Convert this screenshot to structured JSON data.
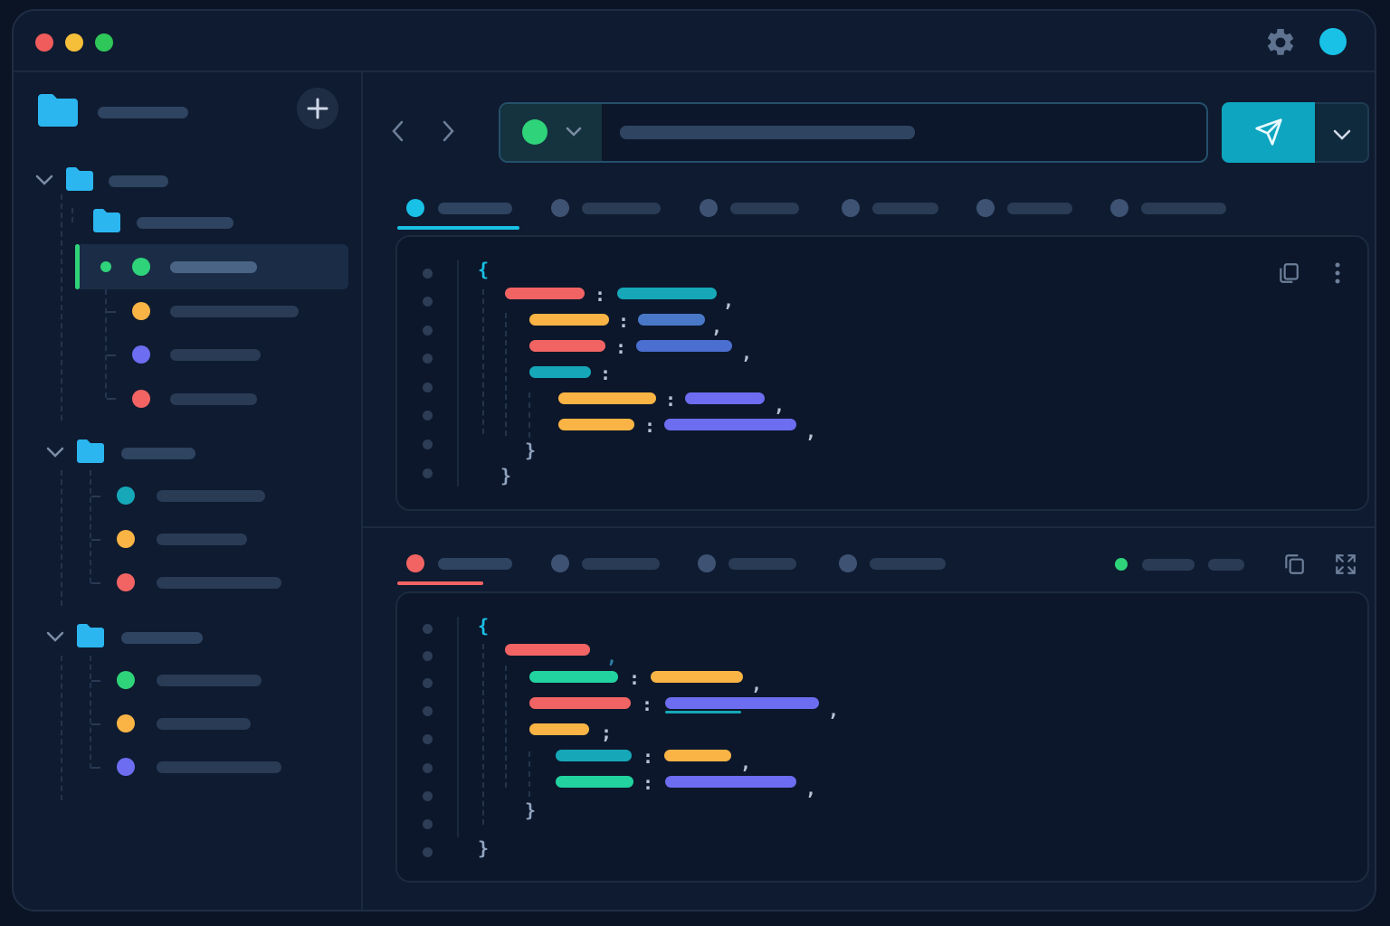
{
  "theme": {
    "accent": "#19c1e6",
    "bg": "#0f1b30",
    "panel": "#0c172b",
    "green": "#2fd37a",
    "orange": "#f9b445",
    "red": "#f26464",
    "purple": "#6c6df0",
    "teal": "#16a8b8",
    "folder": "#2bb6f0"
  },
  "titlebar": {
    "traffic_lights": [
      "#f05b5b",
      "#f5bf3a",
      "#2fc65a"
    ],
    "icons": [
      "gear-icon",
      "avatar"
    ]
  },
  "sidebar": {
    "header_icon": "folder-icon",
    "add_icon": "plus-icon",
    "groups": [
      {
        "icon": "chevron-down-icon",
        "folder": "folder-icon",
        "items": [
          "green",
          "orange",
          "purple",
          "red"
        ],
        "subfolder": true,
        "selected_index": 0
      },
      {
        "icon": "chevron-down-icon",
        "folder": "folder-icon",
        "items": [
          "teal",
          "orange",
          "red"
        ]
      },
      {
        "icon": "chevron-down-icon",
        "folder": "folder-icon",
        "items": [
          "green",
          "orange",
          "purple"
        ]
      }
    ]
  },
  "request_bar": {
    "nav_icons": [
      "chevron-left-icon",
      "chevron-right-icon"
    ],
    "method_status": "green",
    "send_icon": "paper-plane-icon",
    "menu_icon": "chevron-down-icon"
  },
  "top_tabs": {
    "count": 6,
    "active_index": 0
  },
  "top_editor": {
    "open_brace": "{",
    "close_brace_inner": "}",
    "close_brace_outer": "}",
    "colon": ":",
    "comma": ",",
    "icons": [
      "copy-icon",
      "more-vertical-icon"
    ]
  },
  "bottom_tabs": {
    "count": 4,
    "active_index": 0,
    "icons": [
      "copy-icon",
      "expand-icon"
    ]
  },
  "bottom_editor": {
    "open_brace": "{",
    "close_brace_inner": "}",
    "close_brace_outer": "}",
    "colon": ":",
    "semicolon": ";",
    "comma": ","
  }
}
